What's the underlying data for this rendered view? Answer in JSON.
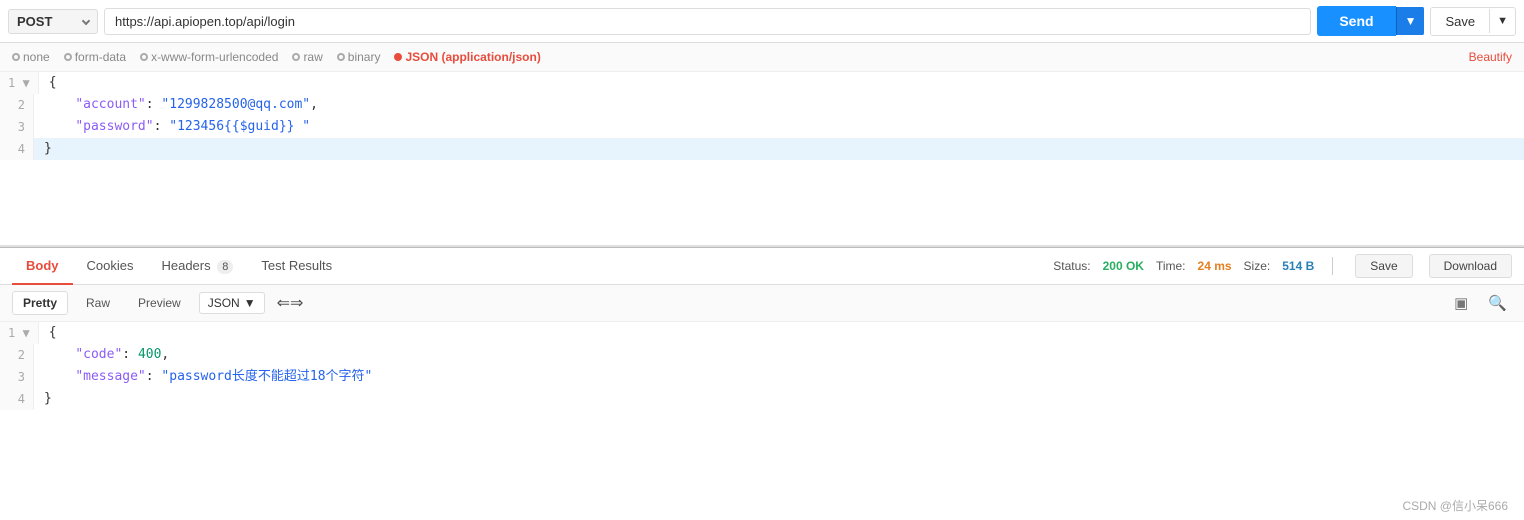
{
  "method": "POST",
  "url": "https://api.apiopen.top/api/login",
  "send_label": "Send",
  "save_label": "Save",
  "request_body_tabs": [
    {
      "label": "none",
      "type": "radio"
    },
    {
      "label": "form-data",
      "type": "radio"
    },
    {
      "label": "x-www-form-urlencoded",
      "type": "radio"
    },
    {
      "label": "raw",
      "type": "radio",
      "active": false
    },
    {
      "label": "binary",
      "type": "radio"
    },
    {
      "label": "JSON (application/json)",
      "type": "badge",
      "active": true
    }
  ],
  "beautify_label": "Beautify",
  "request_code_lines": [
    {
      "num": "1",
      "content": "{",
      "highlighted": false
    },
    {
      "num": "2",
      "content": "    \"account\": \"1299828500@qq.com\",",
      "highlighted": false
    },
    {
      "num": "3",
      "content": "    \"password\": \"123456{{$guid}} \"",
      "highlighted": false
    },
    {
      "num": "4",
      "content": "}",
      "highlighted": true
    }
  ],
  "response_tabs": [
    {
      "label": "Body",
      "active": true
    },
    {
      "label": "Cookies",
      "active": false
    },
    {
      "label": "Headers",
      "badge": "8",
      "active": false
    },
    {
      "label": "Test Results",
      "active": false
    }
  ],
  "status_label": "Status:",
  "status_value": "200 OK",
  "time_label": "Time:",
  "time_value": "24 ms",
  "size_label": "Size:",
  "size_value": "514 B",
  "save_response_label": "Save",
  "download_label": "Download",
  "resp_format_tabs": [
    {
      "label": "Pretty",
      "active": true
    },
    {
      "label": "Raw",
      "active": false
    },
    {
      "label": "Preview",
      "active": false
    }
  ],
  "resp_type": "JSON",
  "response_code_lines": [
    {
      "num": "1",
      "content": "{",
      "highlighted": false
    },
    {
      "num": "2",
      "content": "    \"code\": 400,",
      "highlighted": false
    },
    {
      "num": "3",
      "content": "    \"message\": \"password长度不能超过18个字符\"",
      "highlighted": false
    },
    {
      "num": "4",
      "content": "}",
      "highlighted": false
    }
  ],
  "watermark": "CSDN @信小呆666"
}
